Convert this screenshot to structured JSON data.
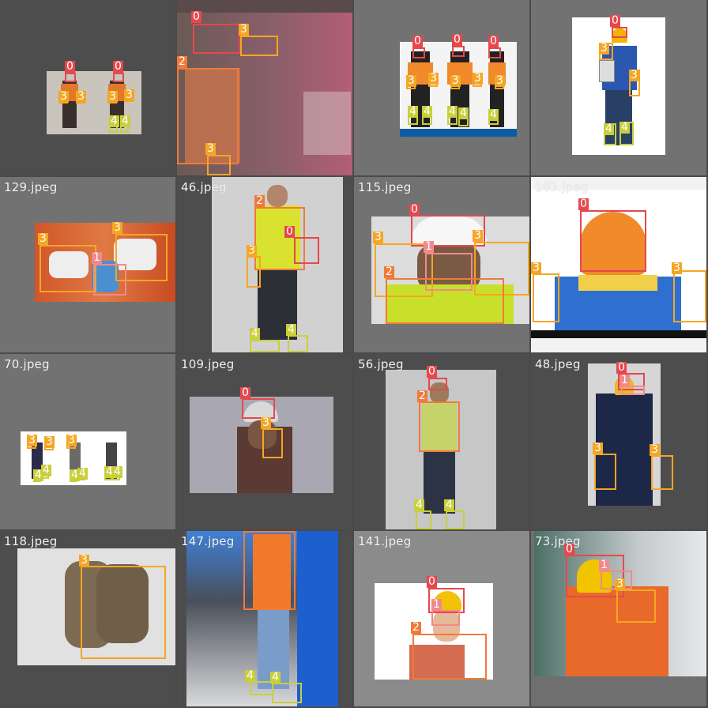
{
  "classes": {
    "0": "0",
    "1": "1",
    "2": "2",
    "3": "3",
    "4": "4"
  },
  "colors": {
    "c0": "#e5484d",
    "c1": "#f08a8a",
    "c2": "#f07a3a",
    "c3": "#f5a623",
    "c4": "#c9cf3a"
  },
  "tiles": [
    {
      "name": "",
      "labels": [
        "0",
        "0",
        "3",
        "3",
        "3",
        "3",
        "4",
        "4"
      ]
    },
    {
      "name": "",
      "labels": [
        "0",
        "3",
        "2",
        "3"
      ]
    },
    {
      "name": "",
      "labels": [
        "0",
        "0",
        "0",
        "3",
        "3",
        "3",
        "3",
        "3",
        "4",
        "4",
        "4",
        "4",
        "4"
      ]
    },
    {
      "name": "",
      "labels": [
        "0",
        "3",
        "3",
        "4",
        "4"
      ]
    },
    {
      "name": "129.jpeg",
      "labels": [
        "3",
        "3",
        "1"
      ]
    },
    {
      "name": "46.jpeg",
      "labels": [
        "2",
        "0",
        "3",
        "4",
        "4"
      ]
    },
    {
      "name": "115.jpeg",
      "labels": [
        "0",
        "3",
        "3",
        "1",
        "2"
      ]
    },
    {
      "name": "103.jpeg",
      "labels": [
        "0",
        "3",
        "3"
      ]
    },
    {
      "name": "70.jpeg",
      "labels": [
        "3",
        "3",
        "3",
        "4",
        "4",
        "4",
        "4",
        "4",
        "4"
      ]
    },
    {
      "name": "109.jpeg",
      "labels": [
        "0",
        "3"
      ]
    },
    {
      "name": "56.jpeg",
      "labels": [
        "0",
        "2",
        "4",
        "4"
      ]
    },
    {
      "name": "48.jpeg",
      "labels": [
        "0",
        "1",
        "3",
        "3"
      ]
    },
    {
      "name": "118.jpeg",
      "labels": [
        "3"
      ]
    },
    {
      "name": "147.jpeg",
      "labels": [
        "2",
        "4",
        "4"
      ]
    },
    {
      "name": "141.jpeg",
      "labels": [
        "0",
        "1",
        "2"
      ]
    },
    {
      "name": "73.jpeg",
      "labels": [
        "0",
        "1",
        "3"
      ]
    }
  ]
}
